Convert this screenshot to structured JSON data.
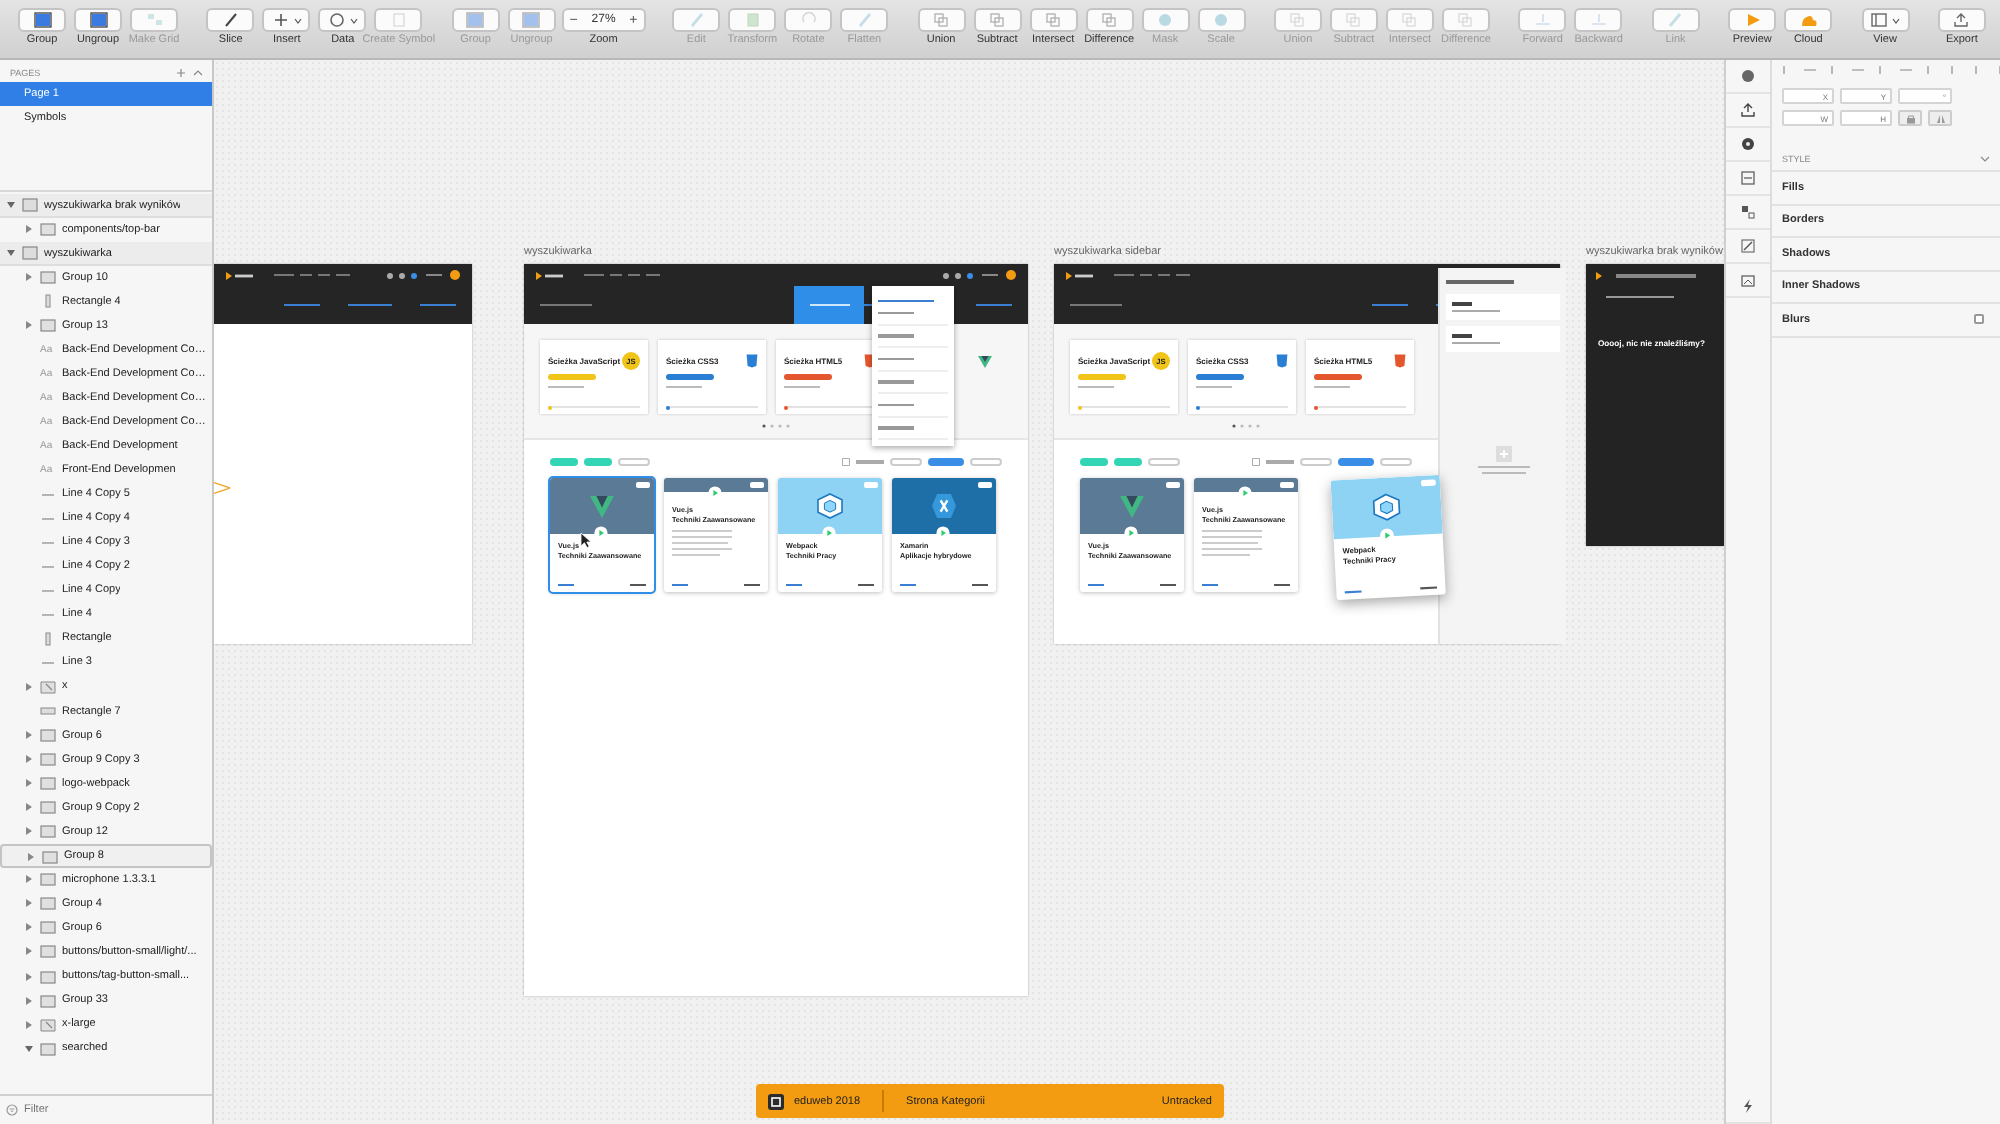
{
  "toolbar": {
    "groups": [
      [
        {
          "label": "Group",
          "kind": "button",
          "disabled": false
        },
        {
          "label": "Ungroup",
          "kind": "button",
          "disabled": false
        },
        {
          "label": "Make Grid",
          "kind": "button",
          "disabled": true
        }
      ],
      [
        {
          "label": "Slice",
          "kind": "button",
          "disabled": false
        },
        {
          "label": "Insert",
          "kind": "menu",
          "disabled": false
        },
        {
          "label": "Data",
          "kind": "menu",
          "disabled": false
        },
        {
          "label": "Create Symbol",
          "kind": "button",
          "disabled": true
        }
      ],
      [
        {
          "label": "Group",
          "kind": "button",
          "disabled": true
        },
        {
          "label": "Ungroup",
          "kind": "button",
          "disabled": true
        },
        {
          "label": "Zoom",
          "kind": "zoom",
          "minus": "−",
          "value": "27%",
          "plus": "+",
          "disabled": false
        }
      ],
      [
        {
          "label": "Edit",
          "kind": "button",
          "disabled": true
        },
        {
          "label": "Transform",
          "kind": "button",
          "disabled": true
        },
        {
          "label": "Rotate",
          "kind": "button",
          "disabled": true
        },
        {
          "label": "Flatten",
          "kind": "button",
          "disabled": true
        }
      ],
      [
        {
          "label": "Union",
          "kind": "button",
          "disabled": false
        },
        {
          "label": "Subtract",
          "kind": "button",
          "disabled": false
        },
        {
          "label": "Intersect",
          "kind": "button",
          "disabled": false
        },
        {
          "label": "Difference",
          "kind": "button",
          "disabled": false
        },
        {
          "label": "Mask",
          "kind": "button",
          "disabled": true
        },
        {
          "label": "Scale",
          "kind": "button",
          "disabled": true
        }
      ],
      [
        {
          "label": "Union",
          "kind": "button",
          "disabled": true
        },
        {
          "label": "Subtract",
          "kind": "button",
          "disabled": true
        },
        {
          "label": "Intersect",
          "kind": "button",
          "disabled": true
        },
        {
          "label": "Difference",
          "kind": "button",
          "disabled": true
        }
      ],
      [
        {
          "label": "Forward",
          "kind": "button",
          "disabled": true
        },
        {
          "label": "Backward",
          "kind": "button",
          "disabled": true
        }
      ],
      [
        {
          "label": "Link",
          "kind": "button",
          "disabled": true
        }
      ],
      [
        {
          "label": "Preview",
          "kind": "button",
          "disabled": false
        },
        {
          "label": "Cloud",
          "kind": "button",
          "disabled": false
        }
      ],
      [
        {
          "label": "View",
          "kind": "menu",
          "disabled": false
        }
      ],
      [
        {
          "label": "Export",
          "kind": "button",
          "disabled": false
        }
      ]
    ]
  },
  "pages": {
    "title": "PAGES",
    "items": [
      {
        "label": "Page 1",
        "selected": true
      },
      {
        "label": "Symbols",
        "selected": false
      }
    ]
  },
  "layers": [
    {
      "name": "wyszukiwarka brak wyników",
      "kind": "artboard",
      "expanded": true,
      "children": [
        {
          "name": "components/top-bar",
          "kind": "group",
          "expanded": false
        }
      ]
    },
    {
      "name": "wyszukiwarka",
      "kind": "artboard",
      "expanded": true,
      "children": [
        {
          "name": "Group 10",
          "kind": "group",
          "expanded": false
        },
        {
          "name": "Rectangle 4",
          "kind": "bar"
        },
        {
          "name": "Group 13",
          "kind": "group",
          "expanded": false
        },
        {
          "name": "Back-End Development Co…",
          "kind": "text",
          "glyph": "Aa"
        },
        {
          "name": "Back-End Development Co…",
          "kind": "text",
          "glyph": "Aa"
        },
        {
          "name": "Back-End Development Co…",
          "kind": "text",
          "glyph": "Aa"
        },
        {
          "name": "Back-End Development Co…",
          "kind": "text",
          "glyph": "Aa"
        },
        {
          "name": "Back-End Development",
          "kind": "text",
          "glyph": "Aa"
        },
        {
          "name": "Front-End Developmen",
          "kind": "text",
          "glyph": "Aa"
        },
        {
          "name": "Line 4 Copy 5",
          "kind": "line"
        },
        {
          "name": "Line 4 Copy 4",
          "kind": "line"
        },
        {
          "name": "Line 4 Copy 3",
          "kind": "line"
        },
        {
          "name": "Line 4 Copy 2",
          "kind": "line"
        },
        {
          "name": "Line 4 Copy",
          "kind": "line"
        },
        {
          "name": "Line 4",
          "kind": "line"
        },
        {
          "name": "Rectangle",
          "kind": "bar"
        },
        {
          "name": "Line 3",
          "kind": "line"
        },
        {
          "name": "x",
          "kind": "shape",
          "expanded": false
        },
        {
          "name": "Rectangle 7",
          "kind": "rect"
        },
        {
          "name": "Group 6",
          "kind": "group",
          "expanded": false
        },
        {
          "name": "Group 9 Copy 3",
          "kind": "group",
          "expanded": false
        },
        {
          "name": "logo-webpack",
          "kind": "group",
          "expanded": false
        },
        {
          "name": "Group 9 Copy 2",
          "kind": "group",
          "expanded": false
        },
        {
          "name": "Group 12",
          "kind": "group",
          "expanded": false
        },
        {
          "name": "Group 8",
          "kind": "group",
          "expanded": false,
          "hovered": true
        },
        {
          "name": "microphone 1.3.3.1",
          "kind": "group",
          "expanded": false
        },
        {
          "name": "Group 4",
          "kind": "group",
          "expanded": false
        },
        {
          "name": "Group 6",
          "kind": "group",
          "expanded": false
        },
        {
          "name": "buttons/button-small/light/...",
          "kind": "group",
          "expanded": false
        },
        {
          "name": "buttons/tag-button-small...",
          "kind": "group",
          "expanded": false
        },
        {
          "name": "Group 33",
          "kind": "group",
          "expanded": false
        },
        {
          "name": "x-large",
          "kind": "shape",
          "expanded": false
        },
        {
          "name": "searched",
          "kind": "group",
          "expanded": true
        }
      ]
    }
  ],
  "filter": {
    "placeholder": "Filter"
  },
  "artboards": [
    {
      "kind": "header"
    },
    {
      "kind": "page",
      "title": "wyszukiwarka",
      "dropdown": true,
      "sidebar": false,
      "paths": [
        {
          "title": "Ścieżka JavaScript",
          "kind": "badge",
          "badge": "JS",
          "color": "#f0c419"
        },
        {
          "title": "Ścieżka CSS3",
          "kind": "shield",
          "color": "#2a7fd4"
        },
        {
          "title": "Ścieżka HTML5",
          "kind": "shield",
          "color": "#e4572e"
        }
      ],
      "courses": [
        {
          "title": "Vue.js",
          "subtitle": "Techniki Zaawansowane",
          "kind": "vue",
          "color": "#5b7a96",
          "selected": true,
          "lifted": false
        },
        {
          "title": "Vue.js",
          "subtitle": "Techniki Zaawansowane",
          "kind": "header",
          "color": "#5b7a96",
          "selected": false,
          "lifted": false
        },
        {
          "title": "Webpack",
          "subtitle": "Techniki Pracy",
          "kind": "webpack",
          "color": "#8fd3f4",
          "selected": false,
          "lifted": false
        },
        {
          "title": "Xamarin",
          "subtitle": "Aplikacje hybrydowe",
          "kind": "xamarin",
          "color": "#1e6fa8",
          "selected": false,
          "lifted": false
        }
      ]
    },
    {
      "kind": "page",
      "title": "wyszukiwarka sidebar",
      "dropdown": false,
      "sidebar": true,
      "paths": [
        {
          "title": "Ścieżka JavaScript",
          "kind": "badge",
          "badge": "JS",
          "color": "#f0c419"
        },
        {
          "title": "Ścieżka CSS3",
          "kind": "shield",
          "color": "#2a7fd4"
        },
        {
          "title": "Ścieżka HTML5",
          "kind": "shield",
          "color": "#e4572e"
        }
      ],
      "courses": [
        {
          "title": "Vue.js",
          "subtitle": "Techniki Zaawansowane",
          "kind": "vue",
          "color": "#5b7a96",
          "selected": false,
          "lifted": false
        },
        {
          "title": "Vue.js",
          "subtitle": "Techniki Zaawansowane",
          "kind": "header",
          "color": "#5b7a96",
          "selected": false,
          "lifted": false
        },
        {
          "title": "Webpack",
          "subtitle": "Techniki Pracy",
          "kind": "webpack",
          "color": "#8fd3f4",
          "selected": false,
          "lifted": true
        }
      ]
    },
    {
      "kind": "empty",
      "title": "wyszukiwarka brak wyników",
      "message": "Ooooj, nic nie znaleźliśmy?"
    }
  ],
  "inspector": {
    "fields": [
      {
        "label": "X"
      },
      {
        "label": "Y"
      },
      {
        "label": "°"
      },
      {
        "label": "W"
      },
      {
        "label": "H"
      }
    ],
    "style_title": "STYLE",
    "sections": [
      {
        "label": "Fills"
      },
      {
        "label": "Borders"
      },
      {
        "label": "Shadows"
      },
      {
        "label": "Inner Shadows"
      },
      {
        "label": "Blurs",
        "checkbox": true,
        "checked": false
      }
    ]
  },
  "status_bar": {
    "project": "eduweb 2018",
    "page": "Strona Kategorii",
    "state": "Untracked"
  }
}
